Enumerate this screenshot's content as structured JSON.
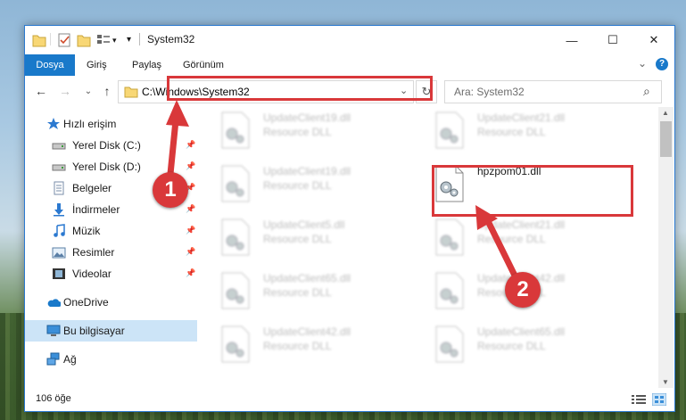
{
  "window": {
    "title": "System32",
    "min_glyph": "—",
    "max_glyph": "☐",
    "close_glyph": "✕"
  },
  "ribbon": {
    "tabs": [
      "Dosya",
      "Giriş",
      "Paylaş",
      "Görünüm"
    ],
    "collapse_glyph": "⌄",
    "help_glyph": "?"
  },
  "nav": {
    "address": "C:\\Windows\\System32",
    "search_placeholder": "Ara: System32",
    "back": "←",
    "forward": "→",
    "recent": "⌄",
    "up": "↑",
    "refresh": "↻",
    "dropdown": "⌄",
    "search_glyph": "⌕"
  },
  "sidebar": {
    "quick_access": "Hızlı erişim",
    "items": [
      {
        "label": "Yerel Disk (C:)",
        "pin": "📌"
      },
      {
        "label": "Yerel Disk (D:)",
        "pin": "📌"
      },
      {
        "label": "Belgeler",
        "pin": "📌"
      },
      {
        "label": "İndirmeler",
        "pin": "📌"
      },
      {
        "label": "Müzik",
        "pin": "📌"
      },
      {
        "label": "Resimler",
        "pin": "📌"
      },
      {
        "label": "Videolar",
        "pin": "📌"
      }
    ],
    "onedrive": "OneDrive",
    "this_pc": "Bu bilgisayar",
    "network": "Ağ"
  },
  "files": {
    "left": [
      {
        "name": "UpdateClient19.dll",
        "type": "Resource DLL"
      },
      {
        "name": "UpdateClient19.dll",
        "type": "Resource DLL"
      },
      {
        "name": "UpdateClient5.dll",
        "type": "Resource DLL"
      },
      {
        "name": "UpdateClient65.dll",
        "type": "Resource DLL"
      },
      {
        "name": "UpdateClient42.dll",
        "type": "Resource DLL"
      }
    ],
    "right": [
      {
        "name": "UpdateClient21.dll",
        "type": "Resource DLL"
      },
      {
        "name": "hpzpom01.dll",
        "type": ""
      },
      {
        "name": "UpdateClient21.dll",
        "type": "Resource DLL"
      },
      {
        "name": "UpdateClient42.dll",
        "type": "Resource DLL"
      },
      {
        "name": "UpdateClient65.dll",
        "type": "Resource DLL"
      }
    ]
  },
  "status": {
    "count": "106 öğe"
  },
  "annotations": {
    "badge1": "1",
    "badge2": "2",
    "color": "#d9383a"
  },
  "colors": {
    "accent": "#1979ca",
    "selection": "#cce4f7",
    "highlight": "#d9383a"
  }
}
